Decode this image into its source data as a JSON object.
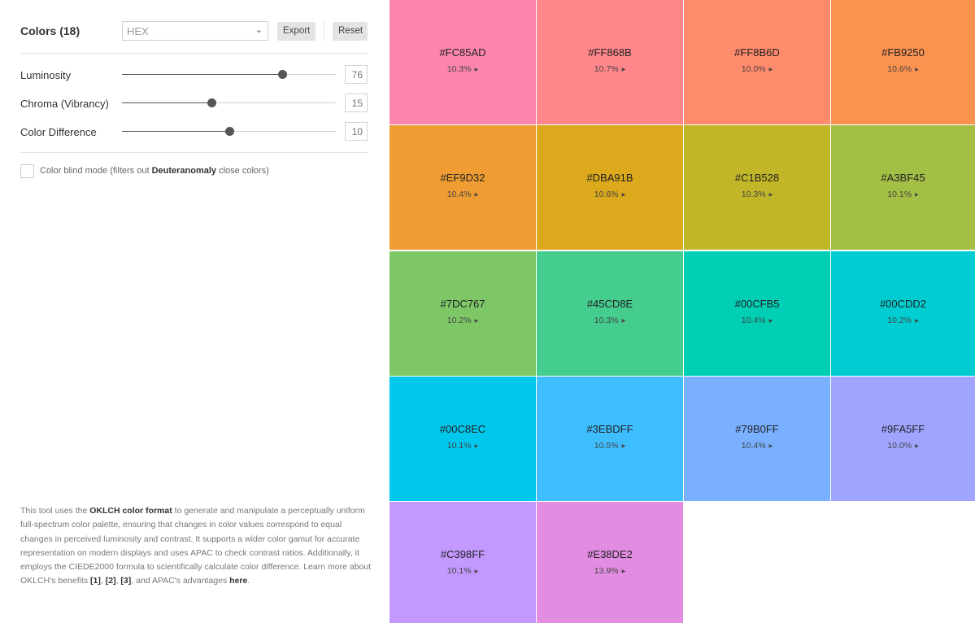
{
  "controls": {
    "title": "Colors (18)",
    "format_value": "HEX",
    "export_label": "Export",
    "reset_label": "Reset",
    "chevron_icon": "chevron-down-icon"
  },
  "sliders": [
    {
      "label": "Luminosity",
      "value": "76",
      "fraction": 0.75
    },
    {
      "label": "Chroma (Vibrancy)",
      "value": "15",
      "fraction": 0.42
    },
    {
      "label": "Color Difference",
      "value": "10",
      "fraction": 0.5
    }
  ],
  "colorblind": {
    "prefix": "Color blind mode (filters out ",
    "strong": "Deuteranomaly",
    "suffix": " close colors)"
  },
  "about": {
    "p1": "This tool uses the ",
    "link1": "OKLCH color format",
    "p2": " to generate and manipulate a perceptually uniform full-spectrum color palette, ensuring that changes in color values correspond to equal changes in perceived luminosity and contrast. It supports a wider color gamut for accurate representation on modern displays and uses APAC to check contrast ratios. Additionally, it employs the CIEDE2000 formula to scientifically calculate color difference. Learn more about OKLCH's benefits ",
    "ref1": "[1]",
    "sep1": ", ",
    "ref2": "[2]",
    "sep2": ", ",
    "ref3": "[3]",
    "p3": ", and APAC's advantages ",
    "link2": "here",
    "p4": "."
  },
  "palette": [
    {
      "hex": "#FC85AD",
      "pct": "10.3%"
    },
    {
      "hex": "#FF868B",
      "pct": "10.7%"
    },
    {
      "hex": "#FF8B6D",
      "pct": "10.0%"
    },
    {
      "hex": "#FB9250",
      "pct": "10.6%"
    },
    {
      "hex": "#EF9D32",
      "pct": "10.4%"
    },
    {
      "hex": "#DBA91B",
      "pct": "10.6%"
    },
    {
      "hex": "#C1B528",
      "pct": "10.3%"
    },
    {
      "hex": "#A3BF45",
      "pct": "10.1%"
    },
    {
      "hex": "#7DC767",
      "pct": "10.2%"
    },
    {
      "hex": "#45CD8E",
      "pct": "10.3%"
    },
    {
      "hex": "#00CFB5",
      "pct": "10.4%"
    },
    {
      "hex": "#00CDD2",
      "pct": "10.2%"
    },
    {
      "hex": "#00C8EC",
      "pct": "10.1%"
    },
    {
      "hex": "#3EBDFF",
      "pct": "10.5%"
    },
    {
      "hex": "#79B0FF",
      "pct": "10.4%"
    },
    {
      "hex": "#9FA5FF",
      "pct": "10.0%"
    },
    {
      "hex": "#C398FF",
      "pct": "10.1%"
    },
    {
      "hex": "#E38DE2",
      "pct": "13.9%"
    }
  ]
}
